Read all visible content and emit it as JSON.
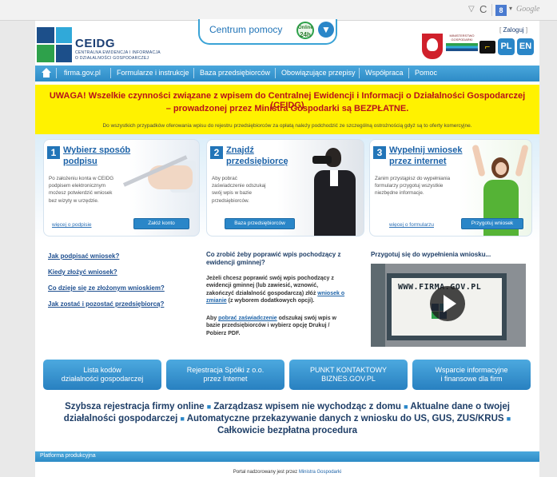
{
  "browser": {
    "chevron": "▽",
    "reload": "C",
    "search_engine_logo": "8",
    "search_dropdown": "▾",
    "search_placeholder": "Google"
  },
  "header": {
    "logo_title": "CEIDG",
    "logo_sub1": "CENTRALNA EWIDENCJA I INFORMACJA",
    "logo_sub2": "O DZIAŁALNOŚCI GOSPODARCZEJ",
    "help_label": "Centrum pomocy",
    "help_badge_top": "Online",
    "help_badge_main": "24h",
    "help_arrow": "▼",
    "ministry_label": "MINISTERSTWO GOSPODARKI",
    "login_label": "Zaloguj",
    "access_icon": "⌐",
    "lang_pl": "PL",
    "lang_en": "EN"
  },
  "nav": {
    "items": [
      "firma.gov.pl",
      "Formularze i instrukcje",
      "Baza przedsiębiorców",
      "Obowiązujące przepisy",
      "Współpraca",
      "Pomoc"
    ]
  },
  "banner": {
    "line1": "UWAGA! Wszelkie czynności związane z wpisem do Centralnej Ewidencji i Informacji o Działalności Gospodarczej (CEIDG)",
    "line2": "– prowadzonej przez Ministra Gospodarki są BEZPŁATNE.",
    "note": "Do wszystkich przypadków oferowania wpisu do rejestru przedsiębiorców za opłatą należy podchodzić ze szczególną ostrożnością gdyż są to oferty komercyjne."
  },
  "steps": [
    {
      "num": "1",
      "title_l1": "Wybierz sposób",
      "title_l2": "podpisu",
      "desc": [
        "Po założeniu konta w CEIDG",
        "podpisem elektronicznym",
        "możesz potwierdzić wniosek",
        "bez wizyty w urzędzie."
      ],
      "more": "więcej o podpisie",
      "button": "Załóż konto"
    },
    {
      "num": "2",
      "title_l1": "Znajdź",
      "title_l2": "przedsiębiorcę",
      "desc": [
        "Aby pobrać",
        "zaświadczenie odszukaj",
        "swój wpis w bazie",
        "przedsiębiorców."
      ],
      "more": "",
      "button": "Baza przedsiębiorców"
    },
    {
      "num": "3",
      "title_l1": "Wypełnij wniosek",
      "title_l2": "przez internet",
      "desc": [
        "Zanim przystąpisz do wypełniania",
        "formularzy przygotuj wszystkie",
        "niezbędne informacje."
      ],
      "more": "więcej o formularzu",
      "button": "Przygotuj wniosek"
    }
  ],
  "faq": [
    "Jak podpisać wniosek?",
    "Kiedy złożyć wniosek?",
    "Co dzieje się ze złożonym wnioskiem?",
    "Jak zostać i pozostać przedsiębiorcą?"
  ],
  "mid": {
    "title_l1": "Co zrobić żeby poprawić wpis pochodzący z",
    "title_l2": "ewidencji gminnej?",
    "p1_l1": "Jeżeli chcesz poprawić swój wpis pochodzący z",
    "p1_l2": "ewidencji gminnej (lub zawiesić, wznowić,",
    "p1_l3a": "zakończyć działalność gospodarczą) złóż ",
    "p1_link1": "wniosek o",
    "p1_link2": "zmianie",
    "p1_l4b": " (z wyborem dodatkowych opcji).",
    "p2_l1a": "Aby ",
    "p2_link": "pobrać zaświadczenie",
    "p2_l1b": " odszukaj swój wpis w",
    "p2_l2": "bazie przedsiębiorców i wybierz opcję Drukuj /",
    "p2_l3": "Pobierz PDF."
  },
  "video": {
    "title": "Przygotuj się do wypełnienia wniosku...",
    "url": "WWW.FIRMA.GOV.PL"
  },
  "big_buttons": [
    {
      "l1": "Lista kodów",
      "l2": "działalności gospodarczej"
    },
    {
      "l1": "Rejestracja Spółki z o.o.",
      "l2": "przez Internet"
    },
    {
      "l1": "PUNKT KONTAKTOWY",
      "l2": "BIZNES.GOV.PL"
    },
    {
      "l1": "Wsparcie informacyjne",
      "l2": "i finansowe dla firm"
    }
  ],
  "promo": {
    "l1a": "Szybsza rejestracja firmy online ",
    "l1b": " Zarządzasz wpisem nie wychodząc z domu ",
    "l1c": " Aktualne dane o twojej",
    "l2a": "działalności gospodarczej ",
    "l2b": " Automatyczne przekazywanie danych z wniosku do US, GUS, ZUS/KRUS ",
    "l3": "Całkowicie bezpłatna procedura",
    "bullet": "■"
  },
  "footer": {
    "bar_label": "Platforma produkcyjna",
    "text": "Portal nadzorowany jest przez ",
    "link": "Ministra Gospodarki"
  },
  "colors": {
    "accent": "#2a86c8",
    "banner_bg": "#fff200",
    "banner_text": "#b8121b",
    "navy": "#1c3f74"
  }
}
